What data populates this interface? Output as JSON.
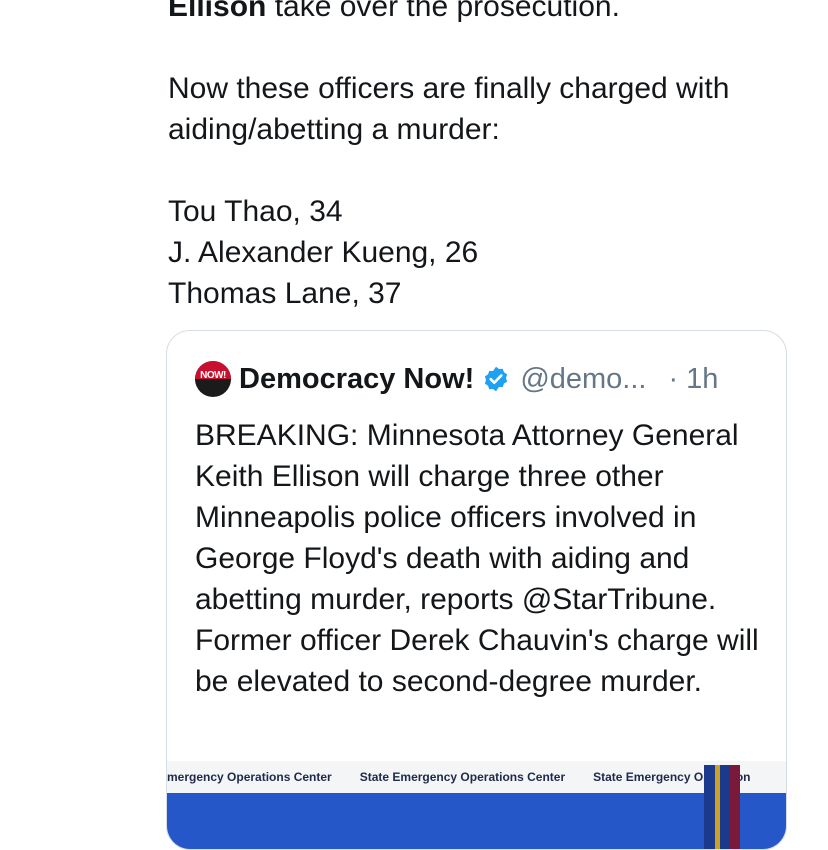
{
  "tweet": {
    "line0_name": "Ellison",
    "line0_rest": " take over the prosecution.",
    "para1": "Now these officers are finally charged with aiding/abetting a murder:",
    "officers": [
      "Tou Thao, 34",
      "J. Alexander Kueng, 26",
      "Thomas Lane, 37"
    ]
  },
  "quote": {
    "avatar_text": "NOW!",
    "name": "Democracy Now!",
    "verified_icon": "verified-badge-icon",
    "handle": "@demo...",
    "time": "· 1h",
    "body": "BREAKING: Minnesota Attorney General Keith Ellison will charge three other Minneapolis police officers involved in George Floyd's death with aiding and abetting murder, reports @StarTribune. Former officer Derek Chauvin's charge will be elevated to second-degree murder.",
    "media": {
      "banner_texts": [
        "mergency Operations Center",
        "State Emergency Operations Center",
        "State Emergency Operation"
      ]
    }
  },
  "colors": {
    "text": "#14171a",
    "secondary": "#657786",
    "verified": "#1da1f2",
    "border": "#d6dde3",
    "media_blue": "#2557c9"
  }
}
